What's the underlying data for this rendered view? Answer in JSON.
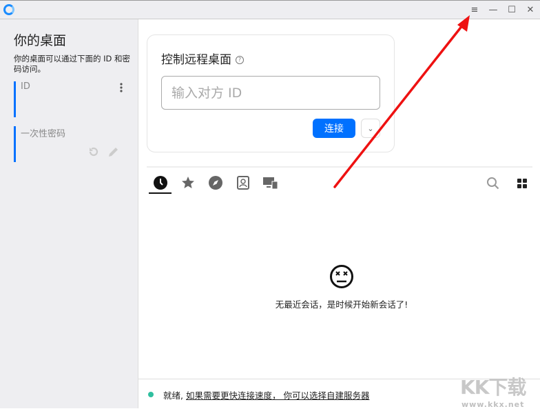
{
  "titlebar": {
    "menu_icon": "hamburger-icon",
    "minimize": "—",
    "maximize": "☐",
    "close": "✕"
  },
  "left": {
    "title": "你的桌面",
    "description": "你的桌面可以通过下面的 ID 和密码访问。",
    "id_label": "ID",
    "password_label": "一次性密码"
  },
  "card": {
    "title": "控制远程桌面",
    "help": "?",
    "id_placeholder": "输入对方 ID",
    "connect_label": "连接",
    "more": "⌄"
  },
  "tabs": [
    "recent-sessions",
    "favorites",
    "discovered",
    "address-book",
    "accessible-devices"
  ],
  "empty": {
    "icon": "dizzy-face",
    "message": "无最近会话，是时候开始新会话了!"
  },
  "status": {
    "ready": "就绪,",
    "link": "如果需要更快连接速度， 你可以选择自建服务器",
    "color": "#2fbf9f"
  },
  "watermark": {
    "logo": "KK下载",
    "url": "www.kkx.net"
  },
  "colors": {
    "accent": "#0071ff",
    "arrow": "#ee1111"
  }
}
